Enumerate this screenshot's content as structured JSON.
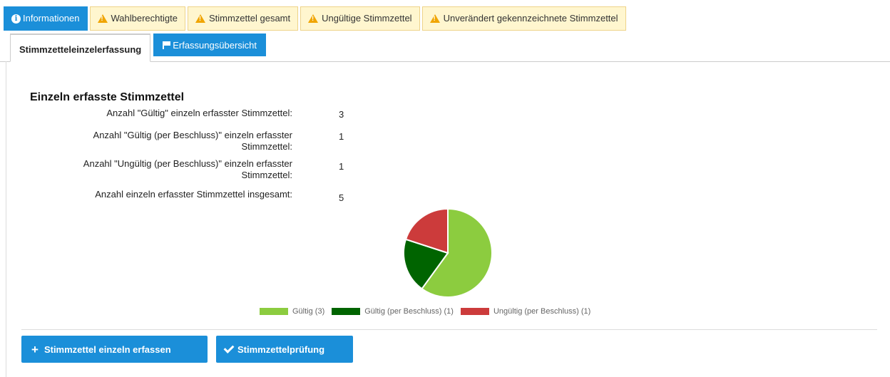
{
  "top_tabs": [
    {
      "label": "Informationen",
      "icon": "info-icon",
      "active": true
    },
    {
      "label": "Wahlberechtigte",
      "icon": "warning-icon",
      "active": false
    },
    {
      "label": "Stimmzettel gesamt",
      "icon": "warning-icon",
      "active": false
    },
    {
      "label": "Ungültige Stimmzettel",
      "icon": "warning-icon",
      "active": false
    },
    {
      "label": "Unverändert gekennzeichnete Stimmzettel",
      "icon": "warning-icon",
      "active": false
    }
  ],
  "sub_tabs": [
    {
      "label": "Stimmzetteleinzelerfassung",
      "active": true
    },
    {
      "label": "Erfassungsübersicht",
      "icon": "flag-icon",
      "active": false
    }
  ],
  "section": {
    "title": "Einzeln erfasste Stimmzettel",
    "rows": [
      {
        "label": "Anzahl \"Gültig\" einzeln erfasster Stimmzettel:",
        "value": "3"
      },
      {
        "label": "Anzahl \"Gültig (per Beschluss)\" einzeln erfasster Stimmzettel:",
        "value": "1"
      },
      {
        "label": "Anzahl \"Ungültig (per Beschluss)\" einzeln erfasster Stimmzettel:",
        "value": "1"
      },
      {
        "label": "Anzahl einzeln erfasster Stimmzettel insgesamt:",
        "value": "5"
      }
    ]
  },
  "chart_data": {
    "type": "pie",
    "slices": [
      {
        "label": "Gültig (3)",
        "value": 3,
        "color": "#8ccc3f"
      },
      {
        "label": "Gültig (per Beschluss) (1)",
        "value": 1,
        "color": "#006400"
      },
      {
        "label": "Ungültig (per Beschluss) (1)",
        "value": 1,
        "color": "#cc3b3b"
      }
    ],
    "legend_position": "bottom"
  },
  "buttons": {
    "add_label": "Stimmzettel einzeln erfassen",
    "check_label": "Stimmzettelprüfung"
  },
  "colors": {
    "accent": "#1b8fd9",
    "tab_warning_bg": "#fff6cf",
    "warning_icon": "#f0a500"
  }
}
